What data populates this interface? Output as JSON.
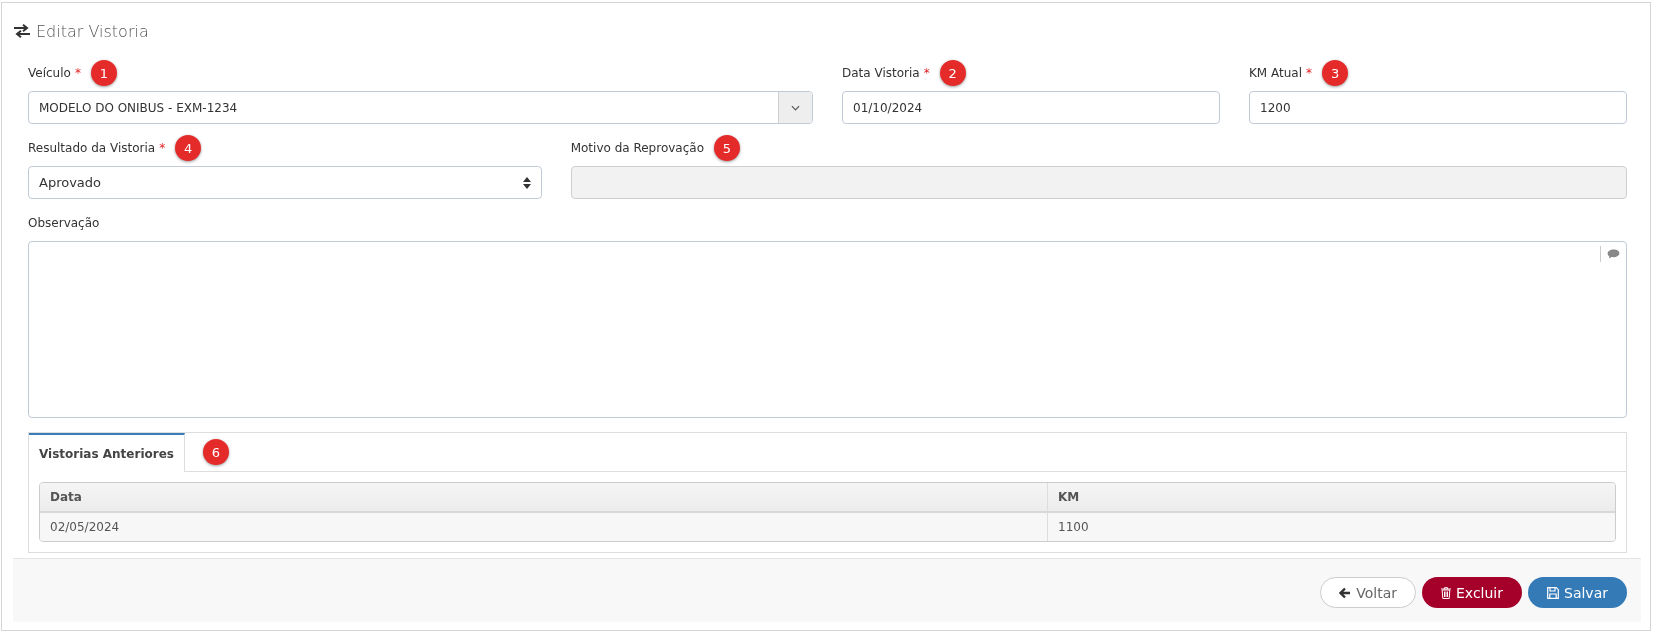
{
  "title": "Editar Vistoria",
  "rows": [
    {
      "fields": [
        {
          "kind": "combo",
          "label": "Veículo",
          "required_mark": "*",
          "badge": "1",
          "value": "MODELO DO ONIBUS - EXM-1234"
        },
        {
          "kind": "text",
          "label": "Data Vistoria",
          "required_mark": "*",
          "badge": "2",
          "value": "01/10/2024"
        },
        {
          "kind": "text",
          "label": "KM Atual",
          "required_mark": "*",
          "badge": "3",
          "value": "1200"
        }
      ]
    },
    {
      "fields": [
        {
          "kind": "select",
          "label": "Resultado da Vistoria",
          "required_mark": "*",
          "badge": "4",
          "value": "Aprovado"
        },
        {
          "kind": "text",
          "label": "Motivo da Reprovação",
          "badge": "5",
          "disabled": true
        }
      ]
    },
    {
      "fields": [
        {
          "kind": "textarea",
          "label": "Observação"
        }
      ]
    }
  ],
  "tabs": [
    {
      "label": "Vistorias Anteriores",
      "selected": true,
      "badge": "6"
    }
  ],
  "table": {
    "columns": [
      "Data",
      "KM"
    ],
    "rows": [
      [
        "02/05/2024",
        "1100"
      ]
    ]
  },
  "buttons": [
    {
      "kind": "back",
      "label": "Voltar"
    },
    {
      "kind": "delete",
      "label": "Excluir"
    },
    {
      "kind": "save",
      "label": "Salvar"
    }
  ]
}
